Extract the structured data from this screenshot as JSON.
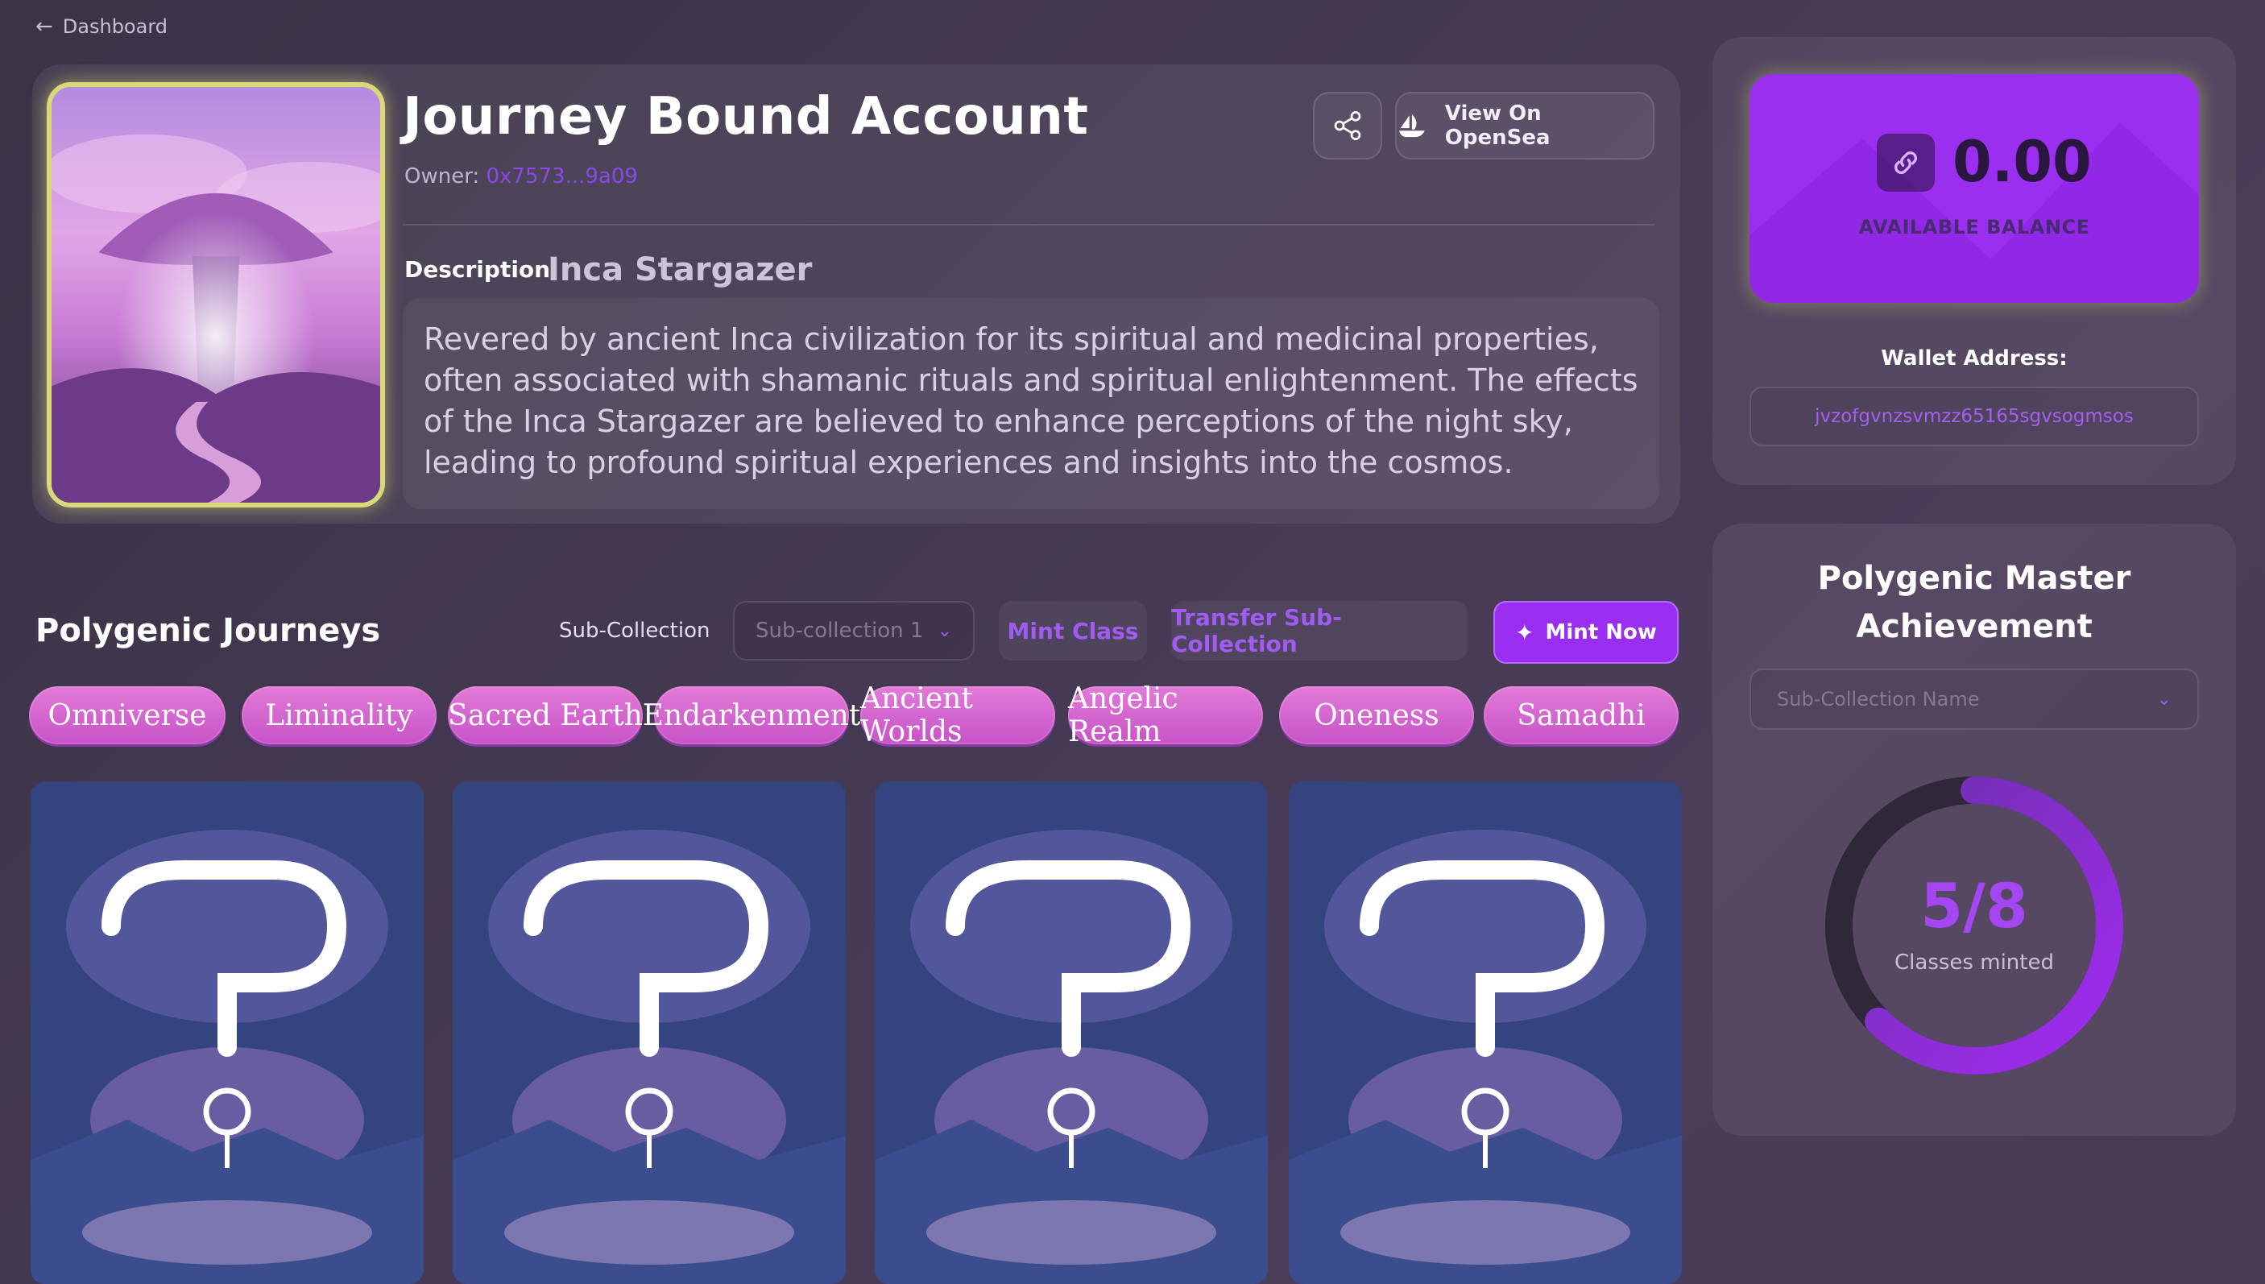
{
  "nav": {
    "back_label": "Dashboard"
  },
  "account": {
    "title": "Journey Bound Account",
    "owner_label": "Owner:",
    "owner_address": "0x7573...9a09",
    "opensea_label": "View On OpenSea",
    "description_label": "Description",
    "description_name": "Inca Stargazer",
    "description_text": "Revered by ancient Inca civilization for its spiritual and medicinal properties, often associated with shamanic rituals and spiritual enlightenment. The effects of the Inca Stargazer are believed to enhance perceptions of the night sky, leading to profound spiritual experiences and insights into the cosmos."
  },
  "journeys": {
    "title": "Polygenic Journeys",
    "subcollection_label": "Sub-Collection",
    "subcollection_value": "Sub-collection 1",
    "mint_class_label": "Mint Class",
    "transfer_label": "Transfer Sub-Collection",
    "mint_now_label": "Mint Now",
    "tabs": [
      "Omniverse",
      "Liminality",
      "Sacred Earth",
      "Endarkenment",
      "Ancient Worlds",
      "Angelic Realm",
      "Oneness",
      "Samadhi"
    ]
  },
  "balance": {
    "value": "0.00",
    "label": "AVAILABLE BALANCE",
    "wallet_label": "Wallet Address:",
    "wallet_address": "jvzofgvnzsvmzz65165sgvsogmsos"
  },
  "achievement": {
    "title_line1": "Polygenic Master",
    "title_line2": "Achievement",
    "select_placeholder": "Sub-Collection Name",
    "progress_text": "5/8",
    "progress_label": "Classes minted",
    "minted": 5,
    "total": 8
  },
  "colors": {
    "accent": "#9a2ef0",
    "tab_pink": "#d865d2",
    "highlight_gold": "#d9d97a"
  },
  "icons": [
    "back-arrow-icon",
    "share-icon",
    "opensea-icon",
    "chevron-down-icon",
    "sparkle-icon",
    "link-icon",
    "question-mark-icon"
  ]
}
